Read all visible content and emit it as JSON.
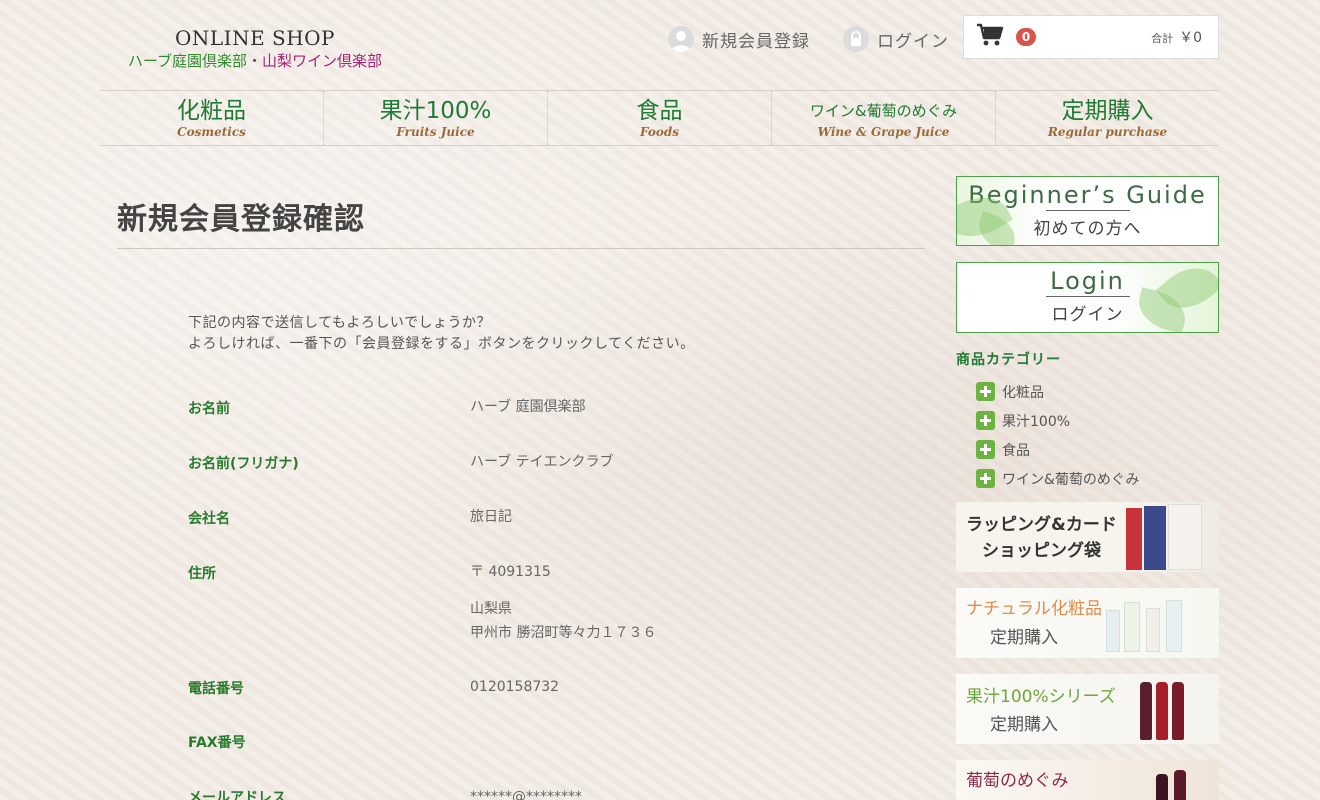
{
  "header": {
    "shop_title": "ONLINE SHOP",
    "shop_sub_1": "ハーブ庭園倶楽部",
    "shop_sub_sep": "・",
    "shop_sub_2": "山梨ワイン倶楽部",
    "register_label": "新規会員登録",
    "login_label": "ログイン",
    "cart_count": "0",
    "cart_total_label": "合計",
    "cart_total_value": "￥0"
  },
  "nav": [
    {
      "jp": "化粧品",
      "en": "Cosmetics"
    },
    {
      "jp": "果汁100%",
      "en": "Fruits Juice"
    },
    {
      "jp": "食品",
      "en": "Foods"
    },
    {
      "jp": "ワイン&葡萄のめぐみ",
      "en": "Wine & Grape Juice"
    },
    {
      "jp": "定期購入",
      "en": "Regular purchase"
    }
  ],
  "main": {
    "page_title": "新規会員登録確認",
    "intro_line1": "下記の内容で送信してもよろしいでしょうか？",
    "intro_line2": "よろしければ、一番下の「会員登録をする」ボタンをクリックしてください。",
    "fields": {
      "name_label": "お名前",
      "name_value": "ハーブ 庭園倶楽部",
      "kana_label": "お名前(フリガナ)",
      "kana_value": "ハーブ テイエンクラブ",
      "company_label": "会社名",
      "company_value": "旅日記",
      "address_label": "住所",
      "postal_value": "〒 4091315",
      "pref_value": "山梨県",
      "city_value": "甲州市 勝沼町等々力１７３６",
      "phone_label": "電話番号",
      "phone_value": "0120158732",
      "fax_label": "FAX番号",
      "fax_value": "",
      "email_label": "メールアドレス",
      "email_value": "******@********"
    }
  },
  "sidebar": {
    "guide_en": "Beginner’s Guide",
    "guide_jp": "初めての方へ",
    "login_en": "Login",
    "login_jp": "ログイン",
    "category_title": "商品カテゴリー",
    "categories": [
      "化粧品",
      "果汁100%",
      "食品",
      "ワイン&葡萄のめぐみ"
    ],
    "promo_wrap_1": "ラッピング&カード",
    "promo_wrap_2": "ショッピング袋",
    "promo_nat_1": "ナチュラル化粧品",
    "promo_nat_2": "定期購入",
    "promo_juice_1": "果汁100%シリーズ",
    "promo_juice_2": "定期購入",
    "promo_wine_1": "葡萄のめぐみ"
  },
  "colors": {
    "accent_green": "#1f7a33",
    "label_green": "#2a7a2e",
    "brand_purple": "#a3246f",
    "cart_badge": "#d9534f",
    "nav_en_brown": "#9a6b3a"
  }
}
